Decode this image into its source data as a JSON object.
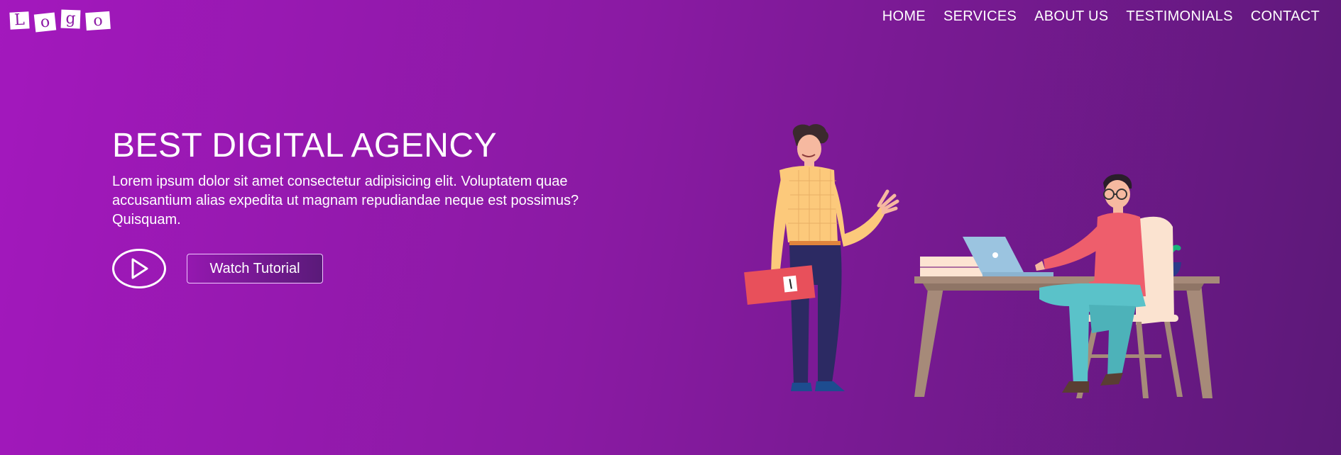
{
  "logo": {
    "letters": [
      "L",
      "o",
      "g",
      "o"
    ]
  },
  "nav": {
    "items": [
      {
        "label": "HOME"
      },
      {
        "label": "SERVICES"
      },
      {
        "label": "ABOUT US"
      },
      {
        "label": "TESTIMONIALS"
      },
      {
        "label": "CONTACT"
      }
    ]
  },
  "hero": {
    "title": "BEST DIGITAL AGENCY",
    "text": "Lorem ipsum dolor sit amet consectetur adipisicing elit. Voluptatem quae accusantium alias expedita ut magnam repudiandae neque est possimus? Quisquam.",
    "play_icon": "play-circle-icon",
    "watch_label": "Watch Tutorial"
  },
  "colors": {
    "bg_start": "#a318bd",
    "bg_end": "#5c1978",
    "text": "#ffffff"
  }
}
